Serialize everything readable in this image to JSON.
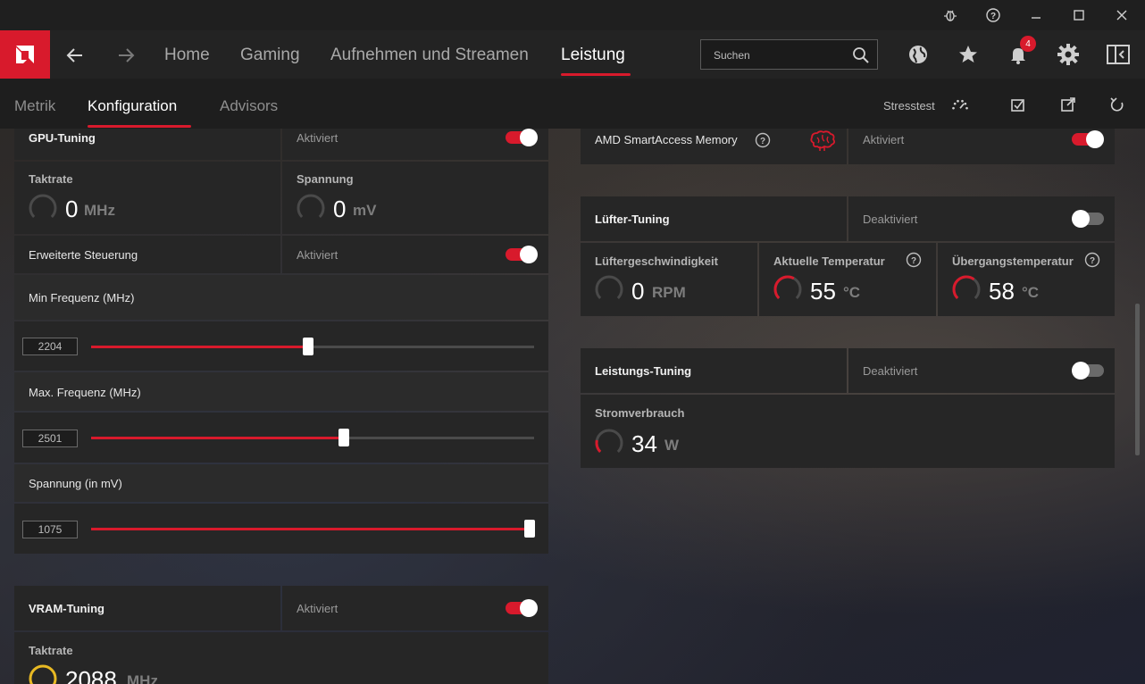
{
  "titlebar": {
    "icons": [
      "bug-icon",
      "help-icon",
      "minimize-icon",
      "maximize-icon",
      "close-icon"
    ]
  },
  "nav": {
    "items": [
      {
        "label": "Home",
        "active": false
      },
      {
        "label": "Gaming",
        "active": false
      },
      {
        "label": "Aufnehmen und Streamen",
        "active": false
      },
      {
        "label": "Leistung",
        "active": true
      }
    ],
    "search_placeholder": "Suchen",
    "notification_count": "4",
    "accent": "#d81a2c"
  },
  "subnav": {
    "tabs": [
      {
        "label": "Metrik",
        "active": false
      },
      {
        "label": "Konfiguration",
        "active": true
      },
      {
        "label": "Advisors",
        "active": false
      }
    ],
    "stresstest_label": "Stresstest"
  },
  "gpu_tuning": {
    "title": "GPU-Tuning",
    "status": "Aktiviert",
    "enabled": true,
    "clock": {
      "label": "Taktrate",
      "value": "0",
      "unit": "MHz"
    },
    "voltage": {
      "label": "Spannung",
      "value": "0",
      "unit": "mV"
    },
    "advanced": {
      "label": "Erweiterte Steuerung",
      "status": "Aktiviert",
      "enabled": true
    },
    "min_freq": {
      "label": "Min Frequenz (MHz)",
      "value": "2204",
      "fraction": 0.49
    },
    "max_freq": {
      "label": "Max. Frequenz (MHz)",
      "value": "2501",
      "fraction": 0.57
    },
    "voltage_slider": {
      "label": "Spannung (in mV)",
      "value": "1075",
      "fraction": 0.99
    }
  },
  "vram_tuning": {
    "title": "VRAM-Tuning",
    "status": "Aktiviert",
    "enabled": true,
    "clock": {
      "label": "Taktrate",
      "value": "2088",
      "unit": "MHz"
    }
  },
  "smart_access": {
    "label": "AMD SmartAccess Memory",
    "status": "Aktiviert",
    "enabled": true
  },
  "fan_tuning": {
    "title": "Lüfter-Tuning",
    "status": "Deaktiviert",
    "enabled": false,
    "fan_speed": {
      "label": "Lüftergeschwindigkeit",
      "value": "0",
      "unit": "RPM"
    },
    "current_temp": {
      "label": "Aktuelle Temperatur",
      "value": "55",
      "unit": "°C"
    },
    "junction_temp": {
      "label": "Übergangstemperatur",
      "value": "58",
      "unit": "°C"
    }
  },
  "power_tuning": {
    "title": "Leistungs-Tuning",
    "status": "Deaktiviert",
    "enabled": false,
    "power": {
      "label": "Stromverbrauch",
      "value": "34",
      "unit": "W"
    }
  }
}
